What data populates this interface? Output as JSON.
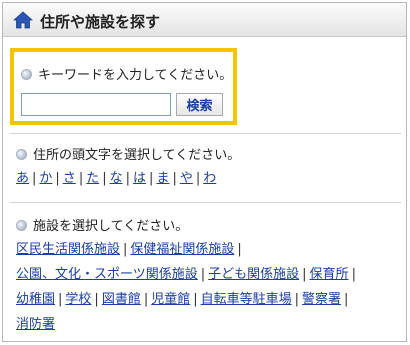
{
  "header": {
    "title": "住所や施設を探す",
    "icon": "home-icon"
  },
  "search": {
    "prompt": "キーワードを入力してください。",
    "input_value": "",
    "placeholder": "",
    "button_label": "検索"
  },
  "address": {
    "prompt": "住所の頭文字を選択してください。",
    "initials": [
      "あ",
      "か",
      "さ",
      "た",
      "な",
      "は",
      "ま",
      "や",
      "わ"
    ]
  },
  "facility": {
    "prompt": "施設を選択してください。",
    "lines": [
      [
        "区民生活関係施設",
        "保健福祉関係施設"
      ],
      [
        "公園、文化・スポーツ関係施設",
        "子ども関係施設",
        "保育所"
      ],
      [
        "幼稚園",
        "学校",
        "図書館",
        "児童館",
        "自転車等駐車場",
        "警察署"
      ],
      [
        "消防署"
      ]
    ]
  },
  "colors": {
    "highlight_border": "#f5c400",
    "link": "#1a3fa0"
  }
}
